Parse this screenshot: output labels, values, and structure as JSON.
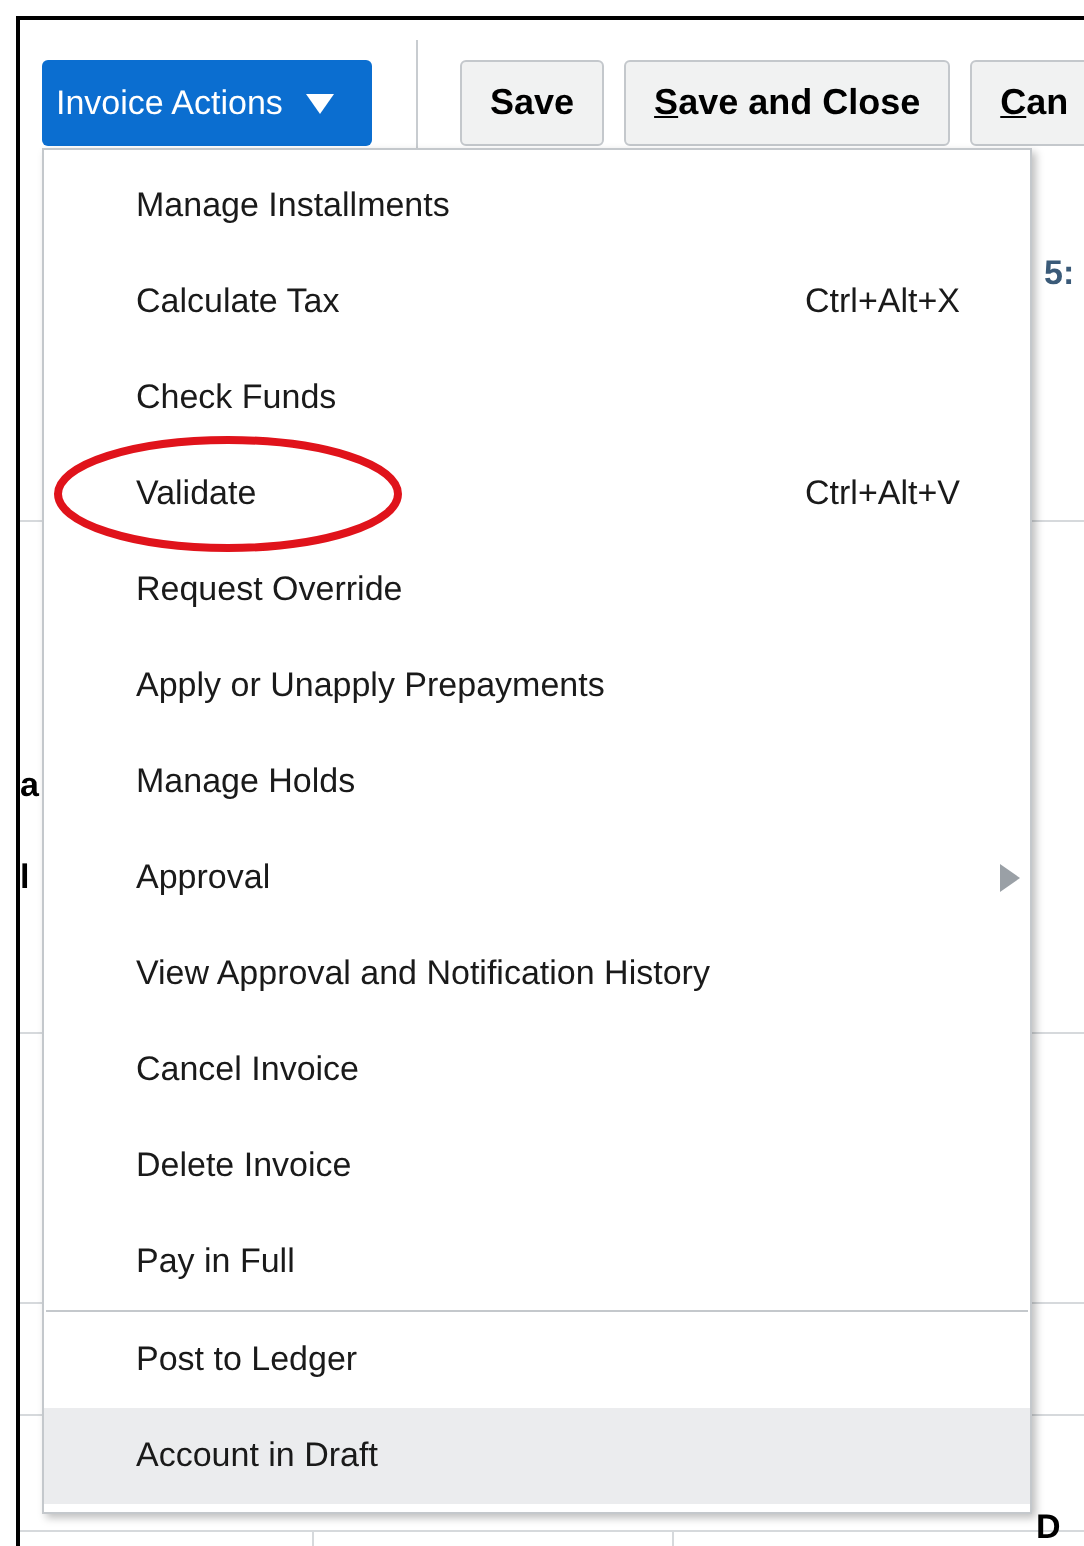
{
  "toolbar": {
    "actions_button": {
      "label": "Invoice Actions"
    },
    "buttons": [
      {
        "label": "Save",
        "mnemonic": false
      },
      {
        "label": "Save and Close",
        "mnemonic": true
      },
      {
        "label": "Can",
        "mnemonic": true
      }
    ]
  },
  "background_fragments": [
    {
      "kind": "time",
      "text": "5:"
    },
    {
      "kind": "label",
      "text": "a"
    },
    {
      "kind": "label",
      "text": "l"
    },
    {
      "kind": "heading",
      "text": "D"
    }
  ],
  "menu": {
    "items": [
      {
        "label": "Manage Installments",
        "kind": "action",
        "highlighted": false,
        "separator_before": false
      },
      {
        "label": "Calculate Tax",
        "shortcut": "Ctrl+Alt+X",
        "kind": "action",
        "highlighted": false,
        "separator_before": false
      },
      {
        "label": "Check Funds",
        "kind": "action",
        "highlighted": false,
        "separator_before": false
      },
      {
        "label": "Validate",
        "shortcut": "Ctrl+Alt+V",
        "kind": "action",
        "highlighted": false,
        "separator_before": false,
        "circled": true
      },
      {
        "label": "Request Override",
        "kind": "action",
        "highlighted": false,
        "separator_before": false
      },
      {
        "label": "Apply or Unapply Prepayments",
        "kind": "action",
        "highlighted": false,
        "separator_before": false
      },
      {
        "label": "Manage Holds",
        "kind": "action",
        "highlighted": false,
        "separator_before": false
      },
      {
        "label": "Approval",
        "kind": "submenu",
        "highlighted": false,
        "separator_before": false
      },
      {
        "label": "View Approval and Notification History",
        "kind": "action",
        "highlighted": false,
        "separator_before": false
      },
      {
        "label": "Cancel Invoice",
        "kind": "action",
        "highlighted": false,
        "separator_before": false
      },
      {
        "label": "Delete Invoice",
        "kind": "action",
        "highlighted": false,
        "separator_before": false
      },
      {
        "label": "Pay in Full",
        "kind": "action",
        "highlighted": false,
        "separator_before": false
      },
      {
        "label": "Post to Ledger",
        "kind": "action",
        "highlighted": false,
        "separator_before": true
      },
      {
        "label": "Account in Draft",
        "kind": "action",
        "highlighted": true,
        "separator_before": false
      }
    ]
  }
}
